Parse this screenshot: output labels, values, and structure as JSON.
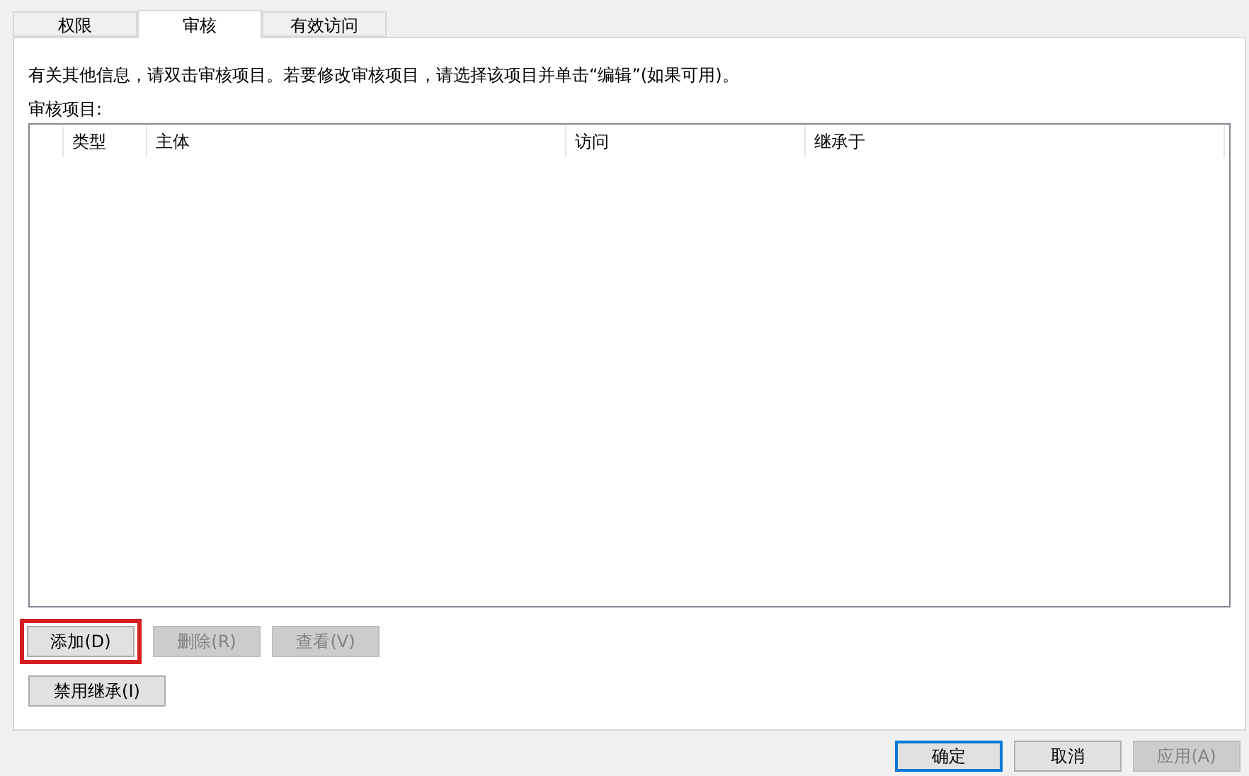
{
  "tabs": [
    {
      "label": "权限",
      "selected": false
    },
    {
      "label": "审核",
      "selected": true
    },
    {
      "label": "有效访问",
      "selected": false
    }
  ],
  "info_text": "有关其他信息，请双击审核项目。若要修改审核项目，请选择该项目并单击“编辑”(如果可用)。",
  "list_label": "审核项目:",
  "table": {
    "columns": [
      "",
      "类型",
      "主体",
      "访问",
      "继承于"
    ]
  },
  "action_buttons": [
    {
      "label": "添加(D)",
      "disabled": false,
      "highlighted": true
    },
    {
      "label": "删除(R)",
      "disabled": true,
      "highlighted": false
    },
    {
      "label": "查看(V)",
      "disabled": true,
      "highlighted": false
    }
  ],
  "inherit_button": {
    "label": "禁用继承(I)",
    "disabled": false
  },
  "dialog_buttons": [
    {
      "label": "确定",
      "disabled": false,
      "default": true
    },
    {
      "label": "取消",
      "disabled": false,
      "default": false
    },
    {
      "label": "应用(A)",
      "disabled": true,
      "default": false
    }
  ]
}
